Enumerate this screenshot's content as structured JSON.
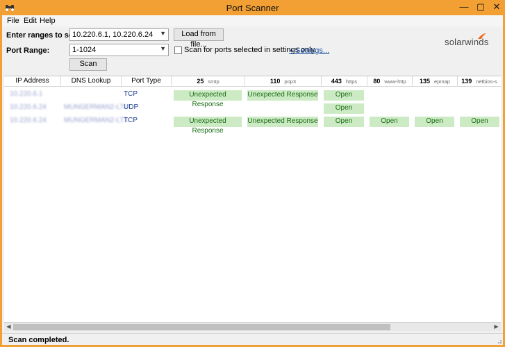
{
  "window": {
    "title": "Port Scanner",
    "min_glyph": "—",
    "max_glyph": "▢",
    "close_glyph": "✕",
    "frame_color": "#f2a033"
  },
  "menu": [
    "File",
    "Edit",
    "Help"
  ],
  "form": {
    "ranges_label": "Enter ranges to scan:",
    "ranges_value": "10.220.6.1, 10.220.6.24",
    "port_range_label": "Port Range:",
    "port_range_value": "1-1024",
    "load_button": "Load from file...",
    "checkbox_label": "Scan for ports selected in settings only.",
    "settings_link": "» Settings...",
    "scan_button": "Scan"
  },
  "logo": {
    "text": "solarwinds",
    "accent": "#f26b1d"
  },
  "grid": {
    "headers": {
      "ip": "IP Address",
      "dns": "DNS Lookup",
      "type": "Port Type"
    },
    "ports": [
      {
        "num": "25",
        "svc": "smtp"
      },
      {
        "num": "110",
        "svc": "pop3"
      },
      {
        "num": "443",
        "svc": "https"
      },
      {
        "num": "80",
        "svc": "www-http"
      },
      {
        "num": "135",
        "svc": "epmap"
      },
      {
        "num": "139",
        "svc": "netbios-s"
      }
    ],
    "rows": [
      {
        "ip": "10.220.6.1",
        "dns": "",
        "type": "TCP",
        "results": [
          "Unexpected Response",
          "Unexpected Response",
          "Open",
          "",
          "",
          ""
        ]
      },
      {
        "ip": "10.220.6.24",
        "dns": "MUNGERMAN2-LT.t",
        "type": "UDP",
        "results": [
          "",
          "",
          "Open",
          "",
          "",
          ""
        ]
      },
      {
        "ip": "10.220.6.24",
        "dns": "MUNGERMAN2-LT.t",
        "type": "TCP",
        "results": [
          "Unexpected Response",
          "Unexpected Response",
          "Open",
          "Open",
          "Open",
          "Open"
        ]
      }
    ]
  },
  "scrollbar": {
    "left_glyph": "◀",
    "right_glyph": "▶"
  },
  "status": "Scan completed."
}
